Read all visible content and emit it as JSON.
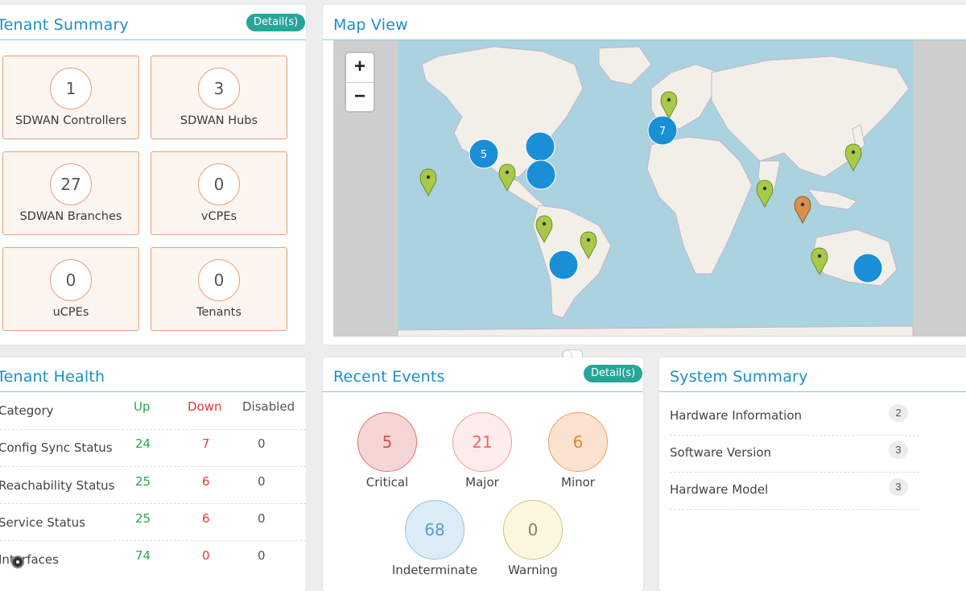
{
  "tenant_summary": {
    "title": "Tenant Summary",
    "detail_label": "Detail(s)",
    "tiles": [
      {
        "value": "1",
        "label": "SDWAN Controllers"
      },
      {
        "value": "3",
        "label": "SDWAN Hubs"
      },
      {
        "value": "27",
        "label": "SDWAN Branches"
      },
      {
        "value": "0",
        "label": "vCPEs"
      },
      {
        "value": "0",
        "label": "uCPEs"
      },
      {
        "value": "0",
        "label": "Tenants"
      }
    ]
  },
  "map_view": {
    "title": "Map View",
    "zoom_in": "+",
    "zoom_out": "−",
    "clusters": [
      {
        "count": "5"
      },
      {
        "count": "7"
      }
    ],
    "colors": {
      "cluster": "#1a8fd6",
      "marker_green": "#a9c94a",
      "marker_orange": "#d98f4e",
      "water": "#aad3df",
      "land": "#f2efe9"
    }
  },
  "tenant_health": {
    "title": "Tenant Health",
    "headers": {
      "category": "Category",
      "up": "Up",
      "down": "Down",
      "disabled": "Disabled"
    },
    "rows": [
      {
        "category": "Config Sync Status",
        "up": "24",
        "down": "7",
        "disabled": "0"
      },
      {
        "category": "Reachability Status",
        "up": "25",
        "down": "6",
        "disabled": "0"
      },
      {
        "category": "Service Status",
        "up": "25",
        "down": "6",
        "disabled": "0"
      },
      {
        "category": "Interfaces",
        "up": "74",
        "down": "0",
        "disabled": "0"
      }
    ]
  },
  "recent_events": {
    "title": "Recent Events",
    "detail_label": "Detail(s)",
    "items": [
      {
        "value": "5",
        "label": "Critical"
      },
      {
        "value": "21",
        "label": "Major"
      },
      {
        "value": "6",
        "label": "Minor"
      },
      {
        "value": "68",
        "label": "Indeterminate"
      },
      {
        "value": "0",
        "label": "Warning"
      }
    ]
  },
  "system_summary": {
    "title": "System Summary",
    "rows": [
      {
        "label": "Hardware Information",
        "count": "2"
      },
      {
        "label": "Software Version",
        "count": "3"
      },
      {
        "label": "Hardware Model",
        "count": "3"
      }
    ]
  }
}
